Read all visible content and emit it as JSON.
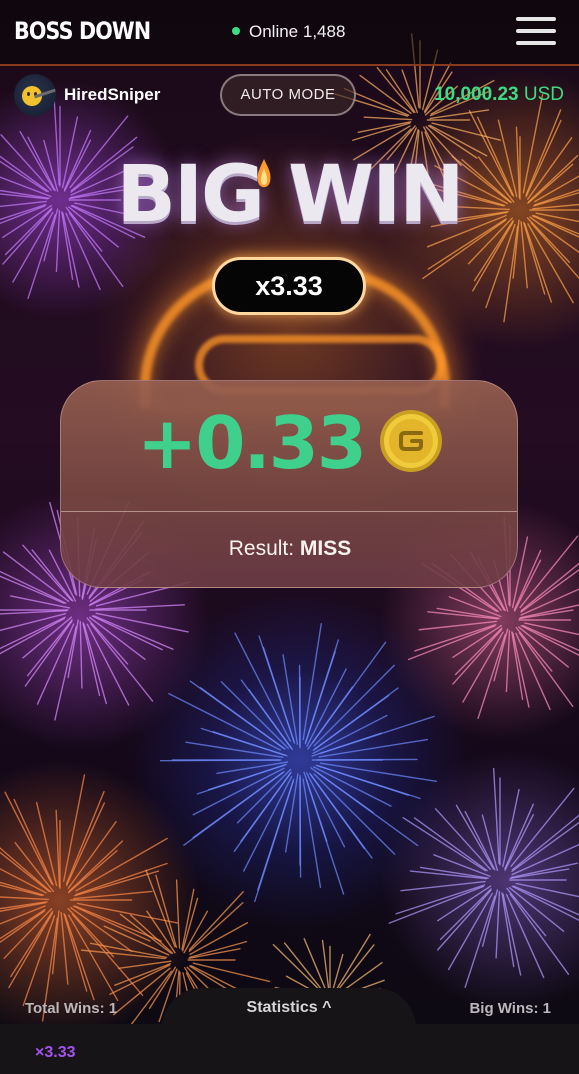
{
  "header": {
    "logo": "BOSS DOWN",
    "online_label": "Online 1,488",
    "online_color": "#3ddc84",
    "menu_icon": "hamburger-menu-icon"
  },
  "player": {
    "username": "HiredSniper",
    "avatar_icon": "sniper-avatar-icon",
    "auto_mode_label": "AUTO MODE",
    "balance_amount": "10,000.23",
    "balance_currency": "USD",
    "balance_color": "#3ddc84"
  },
  "banner": {
    "title": "BIG WIN",
    "multiplier": "x3.33"
  },
  "result": {
    "amount": "+0.33",
    "amount_color": "#3fd08e",
    "coin_icon": "gold-coin-icon",
    "result_label": "Result:",
    "result_value": "MISS"
  },
  "stats": {
    "total_wins": "Total Wins: 1",
    "statistics_label": "Statistics ^",
    "big_wins": "Big Wins: 1",
    "history": [
      "×3.33"
    ],
    "history_color": "#a552f0"
  }
}
